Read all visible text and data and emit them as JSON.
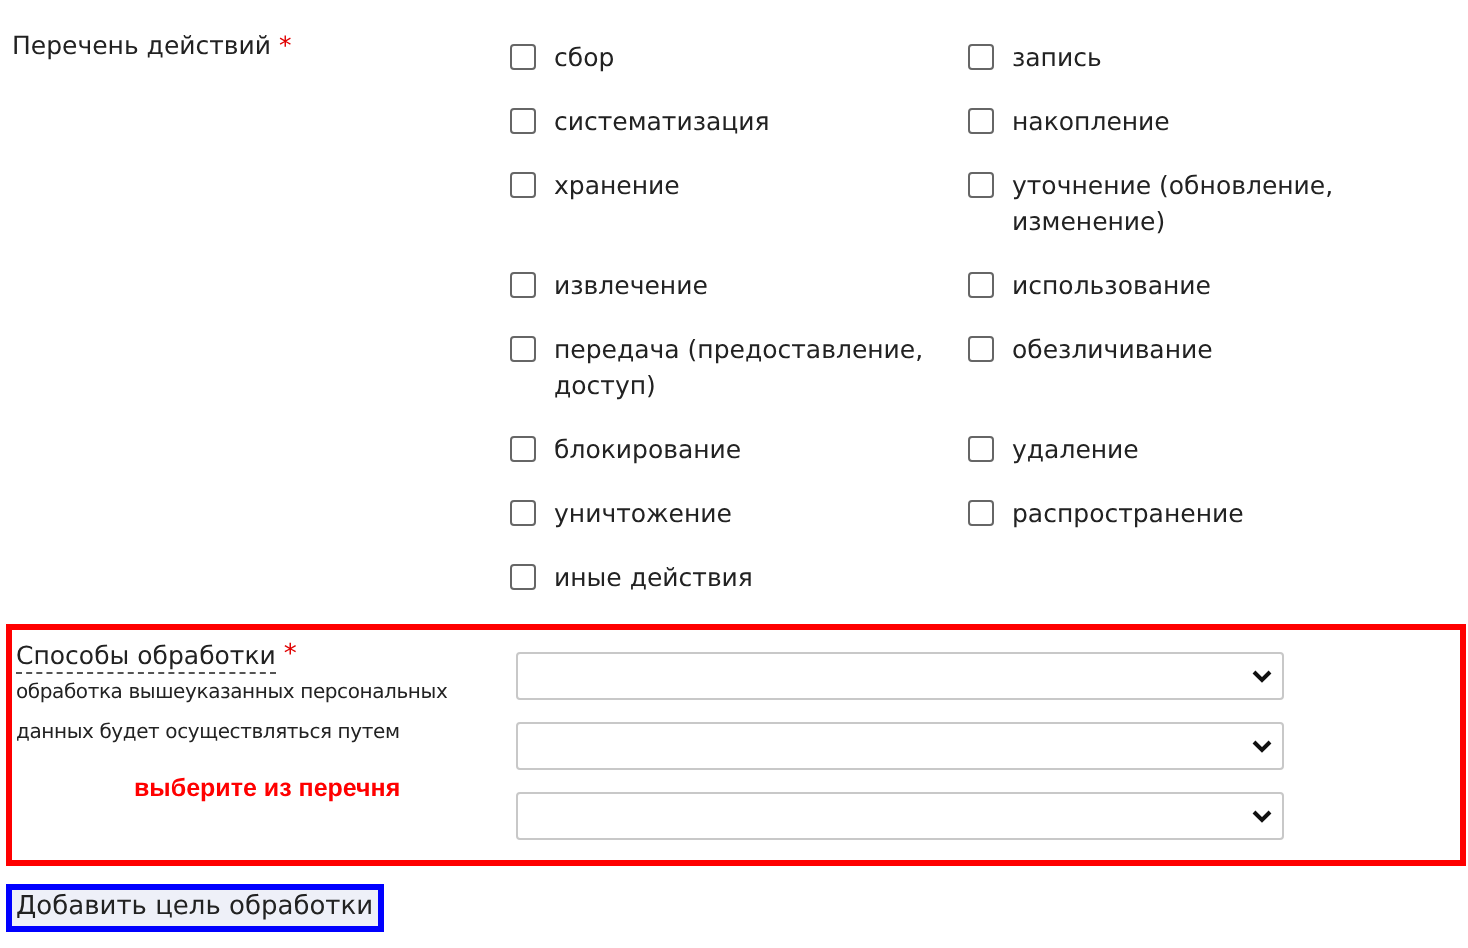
{
  "actions": {
    "label": "Перечень действий",
    "required_mark": "*",
    "options": [
      {
        "label": "сбор",
        "checked": false
      },
      {
        "label": "запись",
        "checked": false
      },
      {
        "label": "систематизация",
        "checked": false
      },
      {
        "label": "накопление",
        "checked": false
      },
      {
        "label": "хранение",
        "checked": false
      },
      {
        "label": "уточнение (обновление, изменение)",
        "checked": false
      },
      {
        "label": "извлечение",
        "checked": false
      },
      {
        "label": "использование",
        "checked": false
      },
      {
        "label": "передача (предоставление, доступ)",
        "checked": false
      },
      {
        "label": "обезличивание",
        "checked": false
      },
      {
        "label": "блокирование",
        "checked": false
      },
      {
        "label": "удаление",
        "checked": false
      },
      {
        "label": "уничтожение",
        "checked": false
      },
      {
        "label": "распространение",
        "checked": false
      },
      {
        "label": "иные действия",
        "checked": false
      }
    ]
  },
  "methods": {
    "label": "Способы обработки",
    "required_mark": "*",
    "hint": "обработка вышеуказанных персональных данных будет осуществляться путем",
    "note": "выберите из перечня",
    "selects": [
      {
        "kind": "dropdown"
      },
      {
        "kind": "dropdown"
      },
      {
        "kind": "dropdown"
      }
    ]
  },
  "add_button": "Добавить цель обработки"
}
